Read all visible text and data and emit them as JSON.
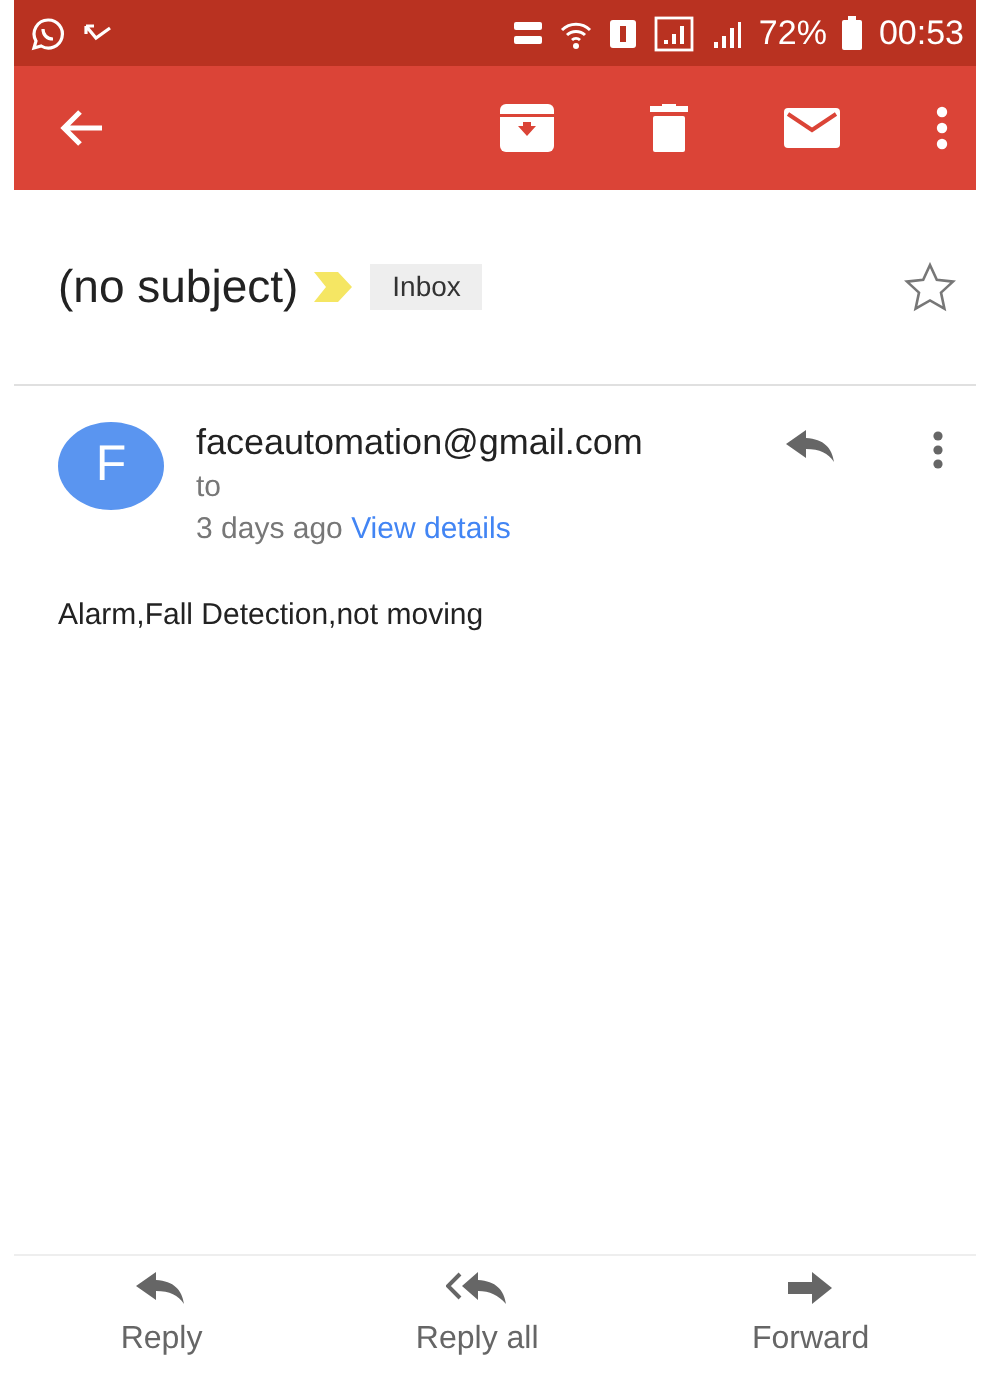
{
  "status_bar": {
    "battery": "72%",
    "time": "00:53"
  },
  "subject": {
    "title": "(no subject)",
    "important": true,
    "label": "Inbox",
    "starred": false
  },
  "message": {
    "avatar_letter": "F",
    "sender": "faceautomation@gmail.com",
    "recipient": "to",
    "time": "3 days ago",
    "details_link": "View details",
    "body": "Alarm,Fall Detection,not moving"
  },
  "actions": [
    {
      "kind": "reply",
      "label": "Reply"
    },
    {
      "kind": "reply_all",
      "label": "Reply all"
    },
    {
      "kind": "forward",
      "label": "Forward"
    }
  ]
}
